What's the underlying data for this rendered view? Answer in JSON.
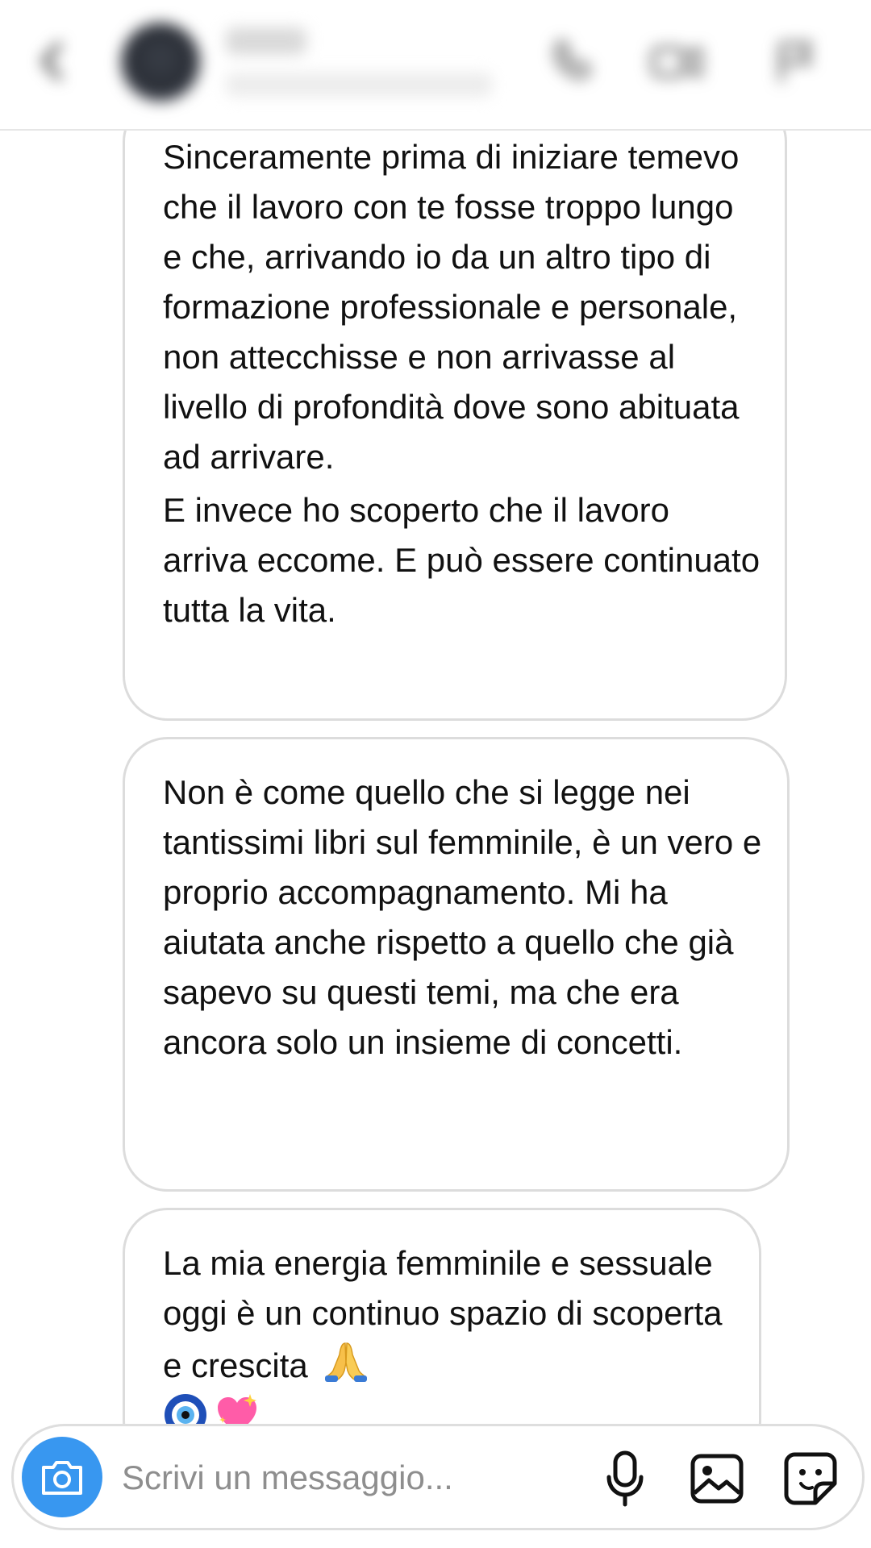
{
  "header": {
    "contact_name": "",
    "contact_status": "",
    "icons": [
      "chevron-left-icon",
      "phone-icon",
      "video-camera-icon",
      "flag-icon"
    ]
  },
  "messages": [
    {
      "paragraphs": [
        "Sinceramente prima di iniziare temevo che il lavoro con te fosse troppo lungo e che, arrivando io da un altro tipo di formazione professionale e personale, non attecchisse e non arrivasse al livello di profondità dove sono abituata ad arrivare.",
        "E invece ho scoperto che il lavoro arriva eccome. E può essere continuato tutta la vita."
      ]
    },
    {
      "paragraphs": [
        "Non è come quello che si legge nei tantissimi libri sul femminile, è un vero e proprio accompagnamento. Mi ha aiutata anche rispetto a quello che già sapevo su questi temi, ma che era ancora solo un insieme di concetti."
      ]
    },
    {
      "paragraphs": [
        "La mia energia femminile e sessuale oggi è un continuo spazio di scoperta e crescita"
      ],
      "emojis": [
        "folded-hands-icon",
        "nazar-amulet-icon",
        "sparkling-heart-icon"
      ]
    }
  ],
  "composer": {
    "placeholder": "Scrivi un messaggio...",
    "icons": [
      "camera-icon",
      "microphone-icon",
      "gallery-icon",
      "sticker-icon"
    ]
  },
  "colors": {
    "accent": "#3897f0",
    "bubble_border": "#dcdcdc",
    "text": "#111111",
    "placeholder": "#8e8e8e"
  }
}
